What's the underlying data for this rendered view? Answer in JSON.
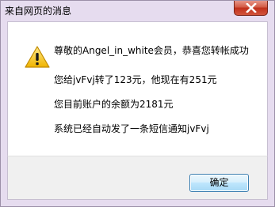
{
  "window": {
    "title": "来自网页的消息",
    "close_icon": "close-icon"
  },
  "message": {
    "icon": "warning-icon",
    "lines": [
      "尊敬的Angel_in_white会员，恭喜您转帐成功",
      "您给jvFvj转了123元，他现在有251元",
      "您目前账户的余额为2181元",
      "系统已经自动发了一条短信通知jvFvj"
    ]
  },
  "buttons": {
    "ok_label": "确定"
  },
  "colors": {
    "frame": "#e6dcef",
    "close_button": "#c0301b",
    "warning_yellow": "#f4c21b"
  }
}
